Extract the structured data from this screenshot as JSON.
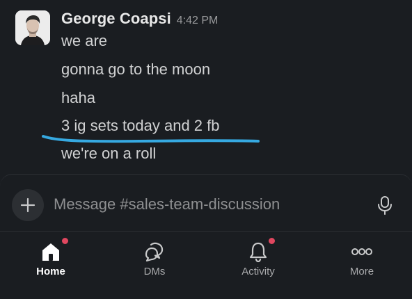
{
  "message": {
    "author": "George Coapsi",
    "timestamp": "4:42 PM",
    "lines": [
      "we are",
      "gonna go to the moon",
      "haha",
      "3 ig sets today and 2 fb",
      "we're on a roll"
    ],
    "highlight_color": "#36a9e1"
  },
  "composer": {
    "placeholder": "Message #sales-team-discussion",
    "add_icon": "plus-icon",
    "mic_icon": "microphone-icon"
  },
  "tabs": [
    {
      "label": "Home",
      "icon": "home-icon",
      "active": true,
      "badge": true
    },
    {
      "label": "DMs",
      "icon": "dms-icon",
      "active": false,
      "badge": false
    },
    {
      "label": "Activity",
      "icon": "bell-icon",
      "active": false,
      "badge": true
    },
    {
      "label": "More",
      "icon": "more-icon",
      "active": false,
      "badge": false
    }
  ],
  "colors": {
    "background": "#1a1d21",
    "badge": "#e0475f",
    "text": "#d1d2d3"
  }
}
